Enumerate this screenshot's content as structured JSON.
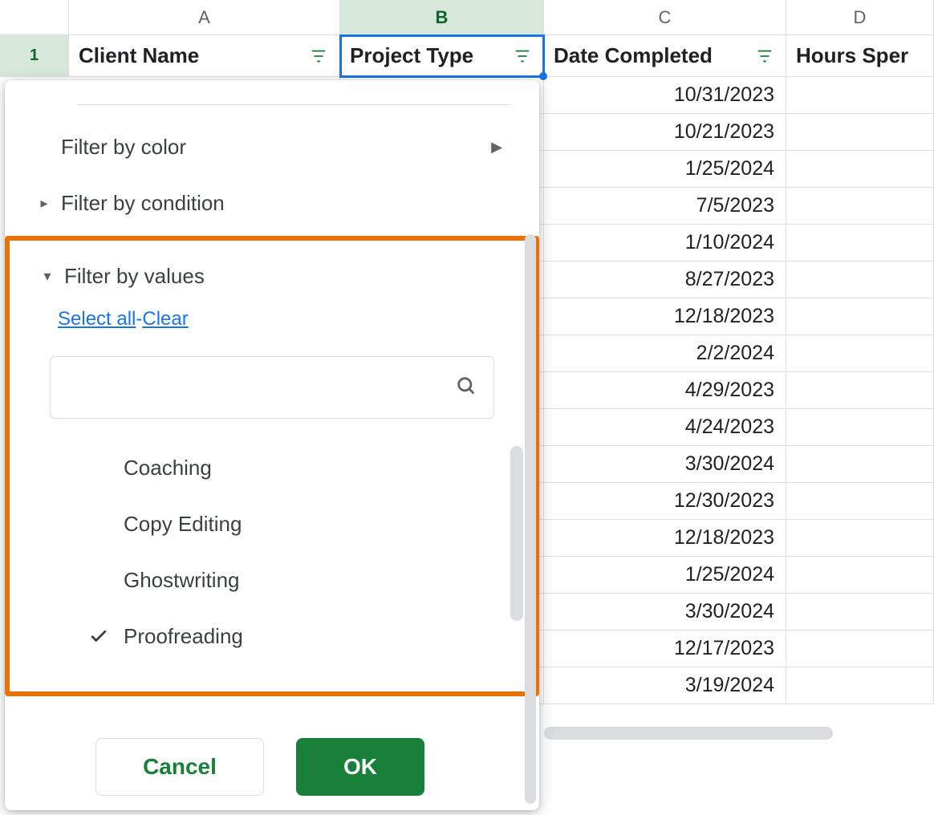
{
  "columns": {
    "letters": [
      "A",
      "B",
      "C",
      "D"
    ],
    "active_index": 1
  },
  "row_number": "1",
  "headers": [
    {
      "label": "Client Name",
      "has_filter": true,
      "selected": false
    },
    {
      "label": "Project Type",
      "has_filter": true,
      "selected": true
    },
    {
      "label": "Date Completed",
      "has_filter": true,
      "selected": false
    },
    {
      "label": "Hours Sper",
      "has_filter": false,
      "selected": false
    }
  ],
  "dates": [
    "10/31/2023",
    "10/21/2023",
    "1/25/2024",
    "7/5/2023",
    "1/10/2024",
    "8/27/2023",
    "12/18/2023",
    "2/2/2024",
    "4/29/2023",
    "4/24/2023",
    "3/30/2024",
    "12/30/2023",
    "12/18/2023",
    "1/25/2024",
    "3/30/2024",
    "12/17/2023",
    "3/19/2024"
  ],
  "filter_panel": {
    "menu": {
      "by_color": "Filter by color",
      "by_condition": "Filter by condition",
      "by_values": "Filter by values"
    },
    "links": {
      "select_all": "Select all",
      "clear": "Clear"
    },
    "search_placeholder": "",
    "values": [
      {
        "label": "Coaching",
        "checked": false
      },
      {
        "label": "Copy Editing",
        "checked": false
      },
      {
        "label": "Ghostwriting",
        "checked": false
      },
      {
        "label": "Proofreading",
        "checked": true
      }
    ],
    "buttons": {
      "cancel": "Cancel",
      "ok": "OK"
    }
  }
}
